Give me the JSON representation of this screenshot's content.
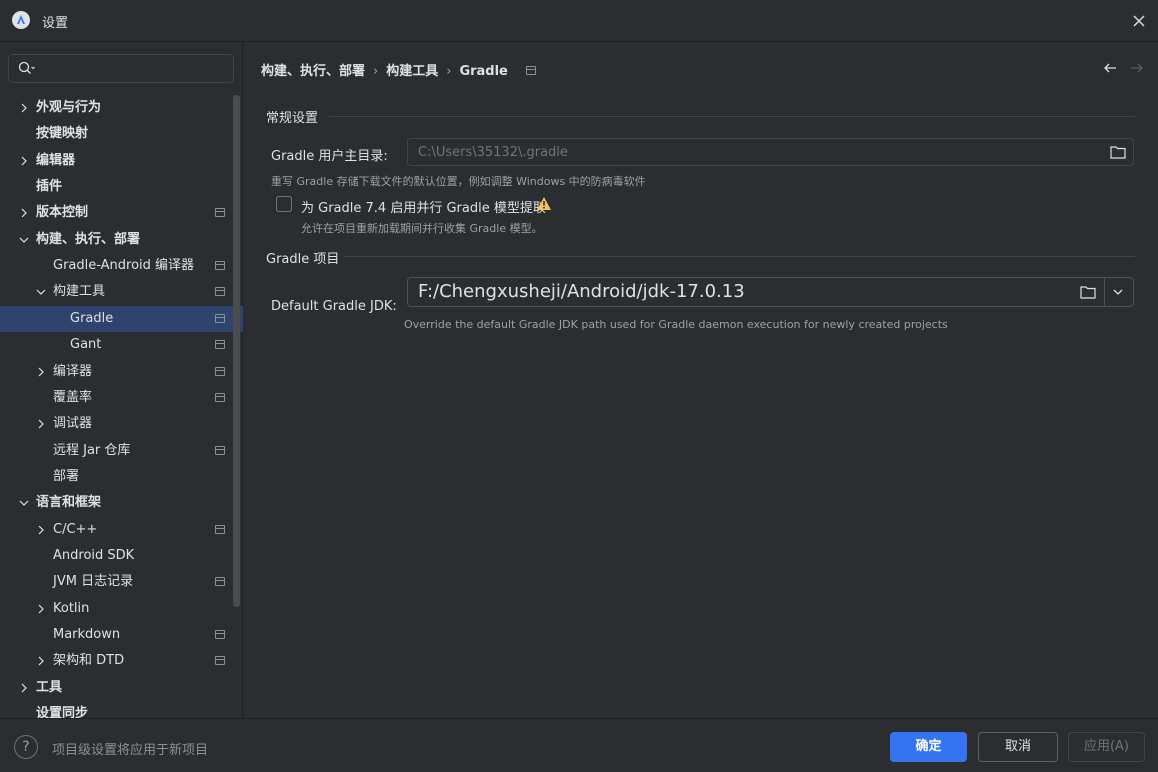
{
  "window": {
    "title": "设置"
  },
  "sidebar": {
    "search_placeholder": "",
    "items": [
      {
        "label": "外观与行为",
        "level": 0,
        "expandable": true,
        "expanded": false,
        "bold": true,
        "project": false
      },
      {
        "label": "按键映射",
        "level": 0,
        "expandable": false,
        "bold": true,
        "project": false
      },
      {
        "label": "编辑器",
        "level": 0,
        "expandable": true,
        "expanded": false,
        "bold": true,
        "project": false
      },
      {
        "label": "插件",
        "level": 0,
        "expandable": false,
        "bold": true,
        "project": false
      },
      {
        "label": "版本控制",
        "level": 0,
        "expandable": true,
        "expanded": false,
        "bold": true,
        "project": true
      },
      {
        "label": "构建、执行、部署",
        "level": 0,
        "expandable": true,
        "expanded": true,
        "bold": true,
        "project": false
      },
      {
        "label": "Gradle-Android 编译器",
        "level": 1,
        "expandable": false,
        "bold": false,
        "project": true
      },
      {
        "label": "构建工具",
        "level": 1,
        "expandable": true,
        "expanded": true,
        "bold": false,
        "project": true
      },
      {
        "label": "Gradle",
        "level": 2,
        "expandable": false,
        "bold": false,
        "project": true,
        "selected": true
      },
      {
        "label": "Gant",
        "level": 2,
        "expandable": false,
        "bold": false,
        "project": true
      },
      {
        "label": "编译器",
        "level": 1,
        "expandable": true,
        "expanded": false,
        "bold": false,
        "project": true
      },
      {
        "label": "覆盖率",
        "level": 1,
        "expandable": false,
        "bold": false,
        "project": true
      },
      {
        "label": "调试器",
        "level": 1,
        "expandable": true,
        "expanded": false,
        "bold": false,
        "project": false
      },
      {
        "label": "远程 Jar 仓库",
        "level": 1,
        "expandable": false,
        "bold": false,
        "project": true
      },
      {
        "label": "部署",
        "level": 1,
        "expandable": false,
        "bold": false,
        "project": false
      },
      {
        "label": "语言和框架",
        "level": 0,
        "expandable": true,
        "expanded": true,
        "bold": true,
        "project": false
      },
      {
        "label": "C/C++",
        "level": 1,
        "expandable": true,
        "expanded": false,
        "bold": false,
        "project": true
      },
      {
        "label": "Android SDK",
        "level": 1,
        "expandable": false,
        "bold": false,
        "project": false
      },
      {
        "label": "JVM 日志记录",
        "level": 1,
        "expandable": false,
        "bold": false,
        "project": true
      },
      {
        "label": "Kotlin",
        "level": 1,
        "expandable": true,
        "expanded": false,
        "bold": false,
        "project": false
      },
      {
        "label": "Markdown",
        "level": 1,
        "expandable": false,
        "bold": false,
        "project": true
      },
      {
        "label": "架构和 DTD",
        "level": 1,
        "expandable": true,
        "expanded": false,
        "bold": false,
        "project": true
      },
      {
        "label": "工具",
        "level": 0,
        "expandable": true,
        "expanded": false,
        "bold": true,
        "project": false
      },
      {
        "label": "设置同步",
        "level": 0,
        "expandable": false,
        "bold": true,
        "project": false
      }
    ]
  },
  "breadcrumb": {
    "items": [
      "构建、执行、部署",
      "构建工具",
      "Gradle"
    ],
    "separator": "›"
  },
  "general": {
    "section_title": "常规设置",
    "user_home_label": "Gradle 用户主目录:",
    "user_home_value": "C:\\Users\\35132\\.gradle",
    "user_home_hint": "重写 Gradle 存储下载文件的默认位置，例如调整 Windows 中的防病毒软件",
    "parallel_label": "为 Gradle 7.4 启用并行 Gradle 模型提取",
    "parallel_checked": false,
    "parallel_hint": "允许在项目重新加载期间并行收集 Gradle 模型。"
  },
  "project": {
    "section_title": "Gradle 项目",
    "jdk_label": "Default Gradle JDK:",
    "jdk_value": "F:/Chengxusheji/Android/jdk-17.0.13",
    "jdk_hint": "Override the default Gradle JDK path used for Gradle daemon execution for newly created projects"
  },
  "footer": {
    "help": "?",
    "hint": "项目级设置将应用于新项目",
    "ok": "确定",
    "cancel": "取消",
    "apply": "应用(A)"
  },
  "colors": {
    "background": "#2b2d30",
    "selection": "#2e436e",
    "accent": "#3574f0",
    "warning": "#f2c55c"
  }
}
